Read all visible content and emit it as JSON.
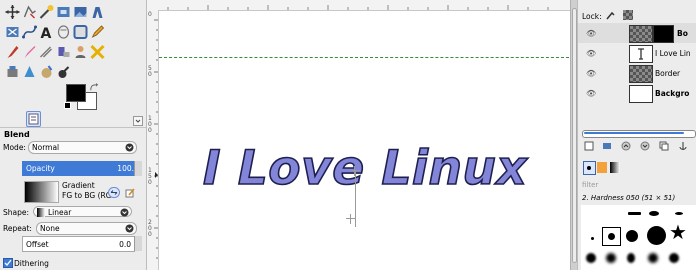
{
  "toolbox": {
    "tools": [
      "align-icon",
      "free-select-icon",
      "fuzzy-select-icon",
      "crop-icon",
      "rectangle-select-icon",
      "ellipse-select-icon",
      "measure-icon",
      "paths-icon",
      "text-icon",
      "heal-icon",
      "clone-icon",
      "pencil-icon",
      "paintbrush-icon",
      "eraser-icon",
      "airbrush-icon",
      "ink-icon",
      "person-icon",
      "transform-icon",
      "bucket-fill-icon",
      "dodge-icon",
      "smudge-icon",
      "blur-icon"
    ],
    "fg_color": "#000000",
    "bg_color": "#ffffff"
  },
  "tool_options": {
    "title": "Blend",
    "mode_label": "Mode:",
    "mode_value": "Normal",
    "opacity_label": "Opacity",
    "opacity_value": "100.",
    "gradient_label": "Gradient",
    "gradient_name": "FG to BG (RG",
    "shape_label": "Shape:",
    "shape_value": "Linear",
    "repeat_label": "Repeat:",
    "repeat_value": "None",
    "offset_label": "Offset",
    "offset_value": "0.0",
    "dithering_label": "Dithering"
  },
  "ruler": {
    "v_labels": [
      "0",
      "5\n0",
      "1\n0\n0",
      "1\n5\n0",
      "2\n0\n0"
    ],
    "h_labels": []
  },
  "canvas": {
    "text": "I Love Linux",
    "text_color": "#8385d8",
    "outline_color": "#1e1f4f",
    "guide_color": "#3a8a3a"
  },
  "layers_panel": {
    "lock_label": "Lock:",
    "layers": [
      {
        "name": "Bo",
        "bold": true
      },
      {
        "name": "I Love Lin",
        "bold": false
      },
      {
        "name": "Border",
        "bold": false
      },
      {
        "name": "Backgro",
        "bold": true
      }
    ]
  },
  "brushes_panel": {
    "filter_placeholder": "filter",
    "brush_name": "2. Hardness 050 (51 × 51)"
  }
}
